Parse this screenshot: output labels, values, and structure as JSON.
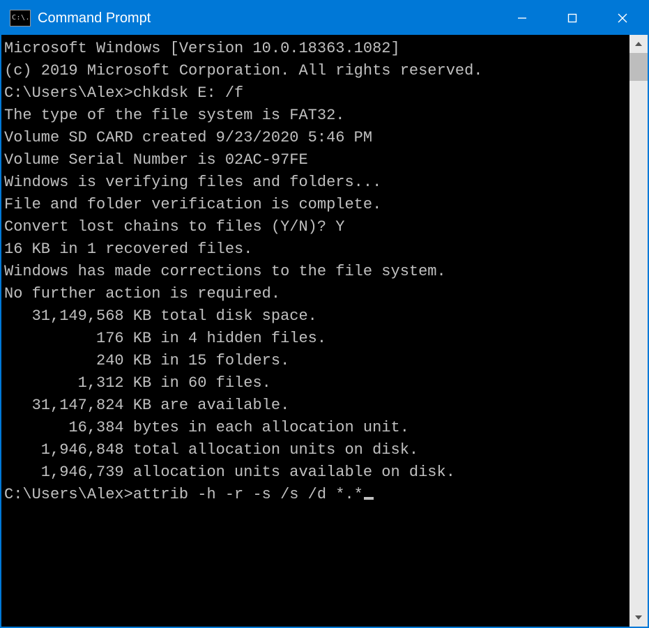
{
  "window": {
    "title": "Command Prompt",
    "icon_text": "C:\\."
  },
  "terminal": {
    "lines": [
      "Microsoft Windows [Version 10.0.18363.1082]",
      "(c) 2019 Microsoft Corporation. All rights reserved.",
      "",
      "C:\\Users\\Alex>chkdsk E: /f",
      "The type of the file system is FAT32.",
      "Volume SD CARD created 9/23/2020 5:46 PM",
      "Volume Serial Number is 02AC-97FE",
      "Windows is verifying files and folders...",
      "File and folder verification is complete.",
      "Convert lost chains to files (Y/N)? Y",
      "16 KB in 1 recovered files.",
      "",
      "Windows has made corrections to the file system.",
      "No further action is required.",
      "   31,149,568 KB total disk space.",
      "          176 KB in 4 hidden files.",
      "          240 KB in 15 folders.",
      "        1,312 KB in 60 files.",
      "   31,147,824 KB are available.",
      "",
      "       16,384 bytes in each allocation unit.",
      "    1,946,848 total allocation units on disk.",
      "    1,946,739 allocation units available on disk.",
      "",
      "C:\\Users\\Alex>attrib -h -r -s /s /d *.*"
    ],
    "current_prompt": "C:\\Users\\Alex>",
    "current_command": "attrib -h -r -s /s /d *.*"
  }
}
